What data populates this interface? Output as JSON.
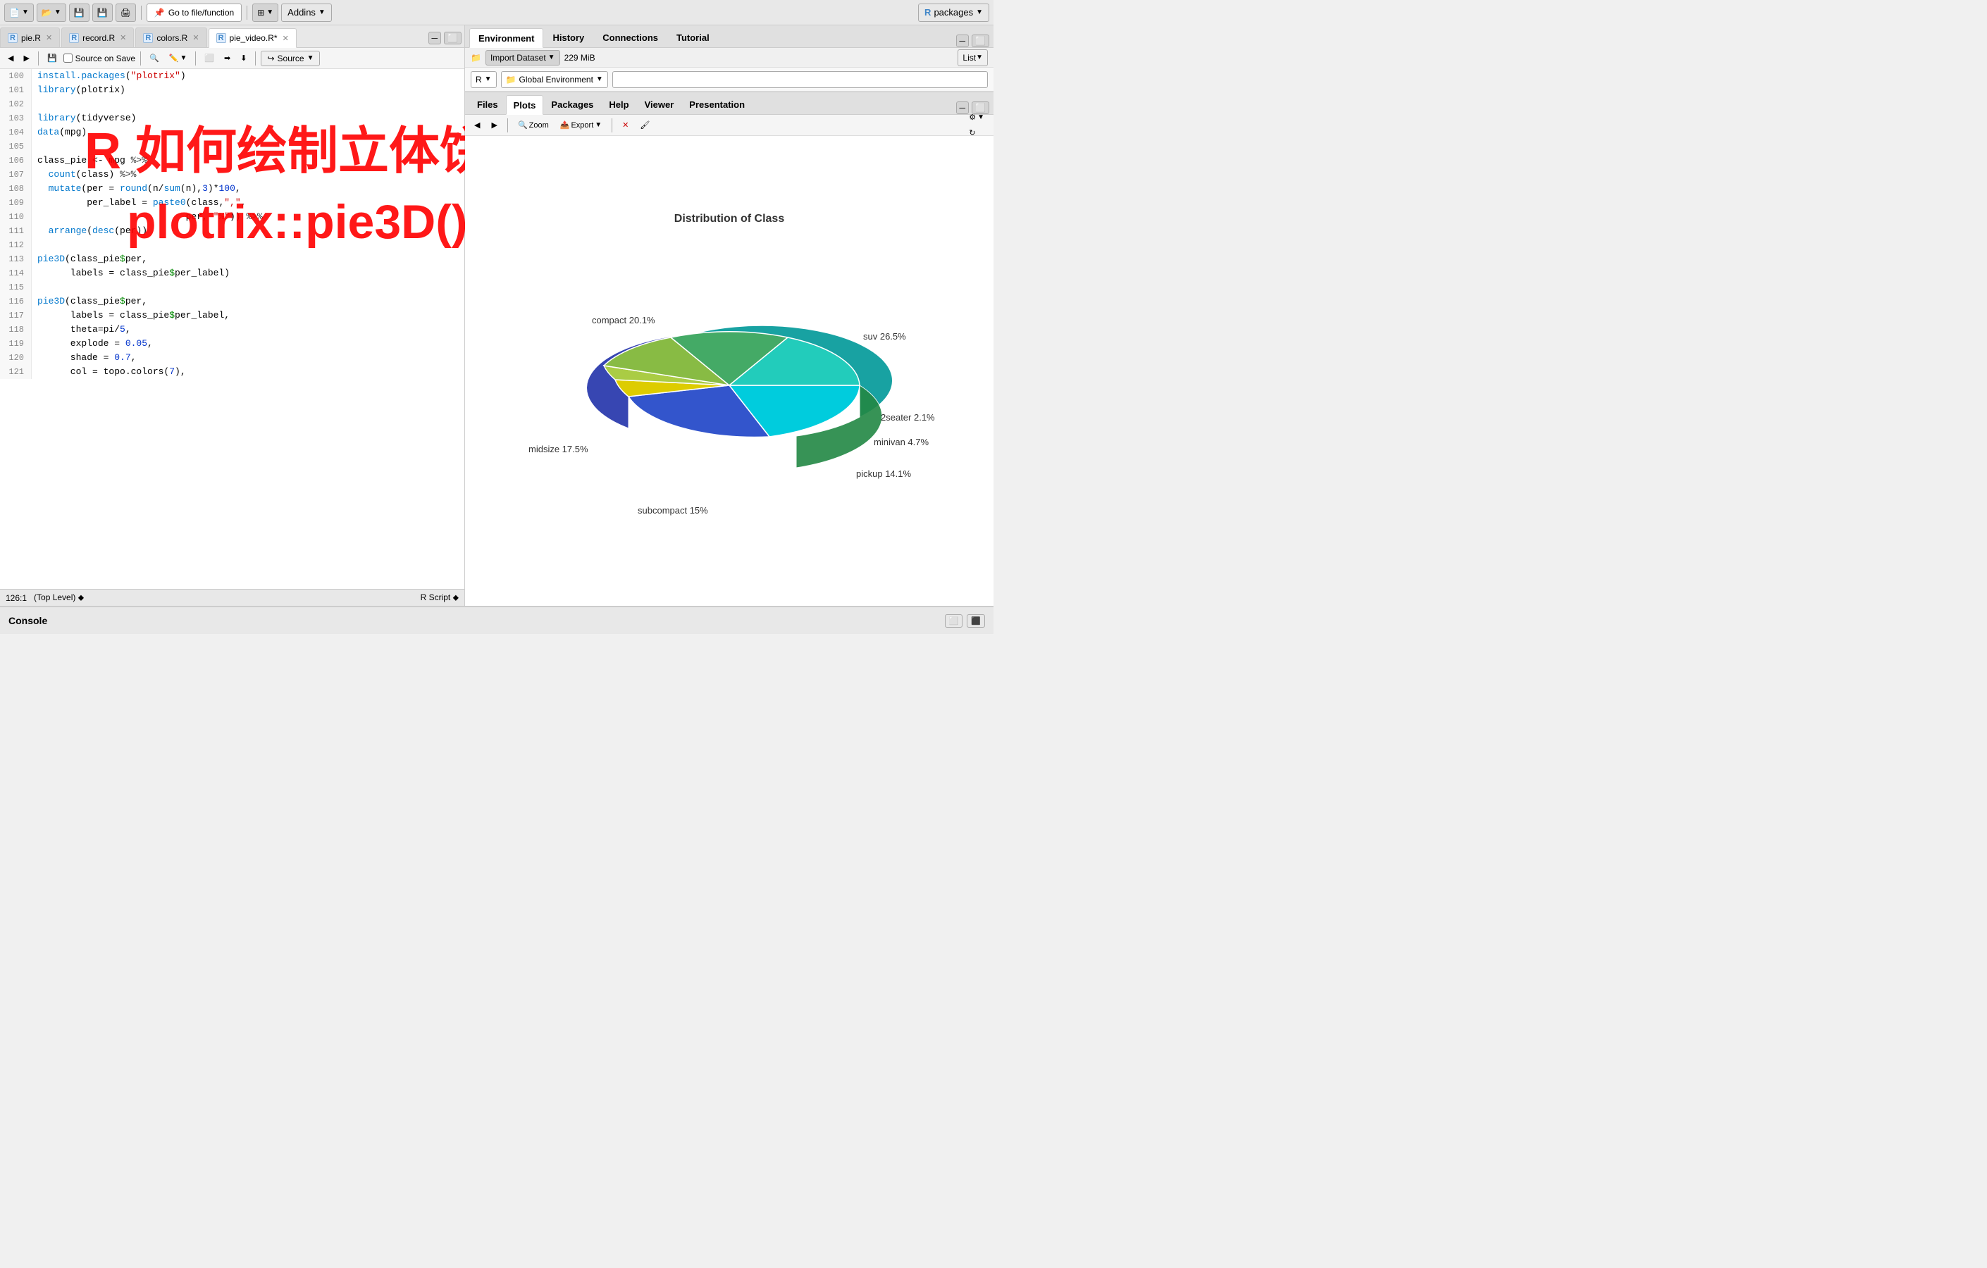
{
  "toolbar": {
    "go_to_file_label": "Go to file/function",
    "addins_label": "Addins",
    "packages_label": "packages",
    "new_file_icon": "📄",
    "open_icon": "📂",
    "save_icon": "💾",
    "print_icon": "🖨"
  },
  "editor": {
    "tabs": [
      {
        "label": "pie.R",
        "active": false,
        "has_icon": true
      },
      {
        "label": "record.R",
        "active": false,
        "has_icon": true
      },
      {
        "label": "colors.R",
        "active": false,
        "has_icon": true
      },
      {
        "label": "pie_video.R*",
        "active": true,
        "has_icon": true
      }
    ],
    "toolbar": {
      "source_on_save_label": "Source on Save",
      "source_label": "Source"
    },
    "status": {
      "position": "126:1",
      "level": "(Top Level)",
      "type": "R Script"
    },
    "lines": [
      {
        "num": 100,
        "code": "install.packages(\"plotrix\")"
      },
      {
        "num": 101,
        "code": "library(plotrix)"
      },
      {
        "num": 102,
        "code": ""
      },
      {
        "num": 103,
        "code": "library(tidyverse)"
      },
      {
        "num": 104,
        "code": "data(mpg)"
      },
      {
        "num": 105,
        "code": ""
      },
      {
        "num": 106,
        "code": "class_pie <- mpg %>%"
      },
      {
        "num": 107,
        "code": "  count(class) %>%"
      },
      {
        "num": 108,
        "code": "  mutate(per = round(n/sum(n),3)*100,"
      },
      {
        "num": 109,
        "code": "         per_label = paste0(class,\",\","
      },
      {
        "num": 110,
        "code": "                           per, \"%\")) %>%"
      },
      {
        "num": 111,
        "code": "  arrange(desc(per))"
      },
      {
        "num": 112,
        "code": ""
      },
      {
        "num": 113,
        "code": "pie3D(class_pie$per,"
      },
      {
        "num": 114,
        "code": "      labels = class_pie$per_label)"
      },
      {
        "num": 115,
        "code": ""
      },
      {
        "num": 116,
        "code": "pie3D(class_pie$per,"
      },
      {
        "num": 117,
        "code": "      labels = class_pie$per_label,"
      },
      {
        "num": 118,
        "code": "      theta=pi/5,"
      },
      {
        "num": 119,
        "code": "      explode = 0.05,"
      },
      {
        "num": 120,
        "code": "      shade = 0.7,"
      },
      {
        "num": 121,
        "code": "      col = topo.colors(7),"
      }
    ]
  },
  "overlay": {
    "title": "R 如何绘制立体饼图?",
    "subtitle": "plotrix::pie3D()"
  },
  "right_panel": {
    "env_tabs": [
      {
        "label": "Environment",
        "active": true
      },
      {
        "label": "History",
        "active": false
      },
      {
        "label": "Connections",
        "active": false
      },
      {
        "label": "Tutorial",
        "active": false
      }
    ],
    "env_toolbar": {
      "import_dataset": "Import Dataset",
      "memory": "229 MiB",
      "list_view": "List"
    },
    "r_dropdown": "R",
    "global_env": "Global Environment",
    "search_placeholder": ""
  },
  "files_panel": {
    "tabs": [
      {
        "label": "Files",
        "active": false
      },
      {
        "label": "Plots",
        "active": true
      },
      {
        "label": "Packages",
        "active": false
      },
      {
        "label": "Help",
        "active": false
      },
      {
        "label": "Viewer",
        "active": false
      },
      {
        "label": "Presentation",
        "active": false
      }
    ],
    "toolbar": {
      "zoom_label": "Zoom",
      "export_label": "Export"
    },
    "chart_title": "Distribution of Class",
    "chart_labels": [
      {
        "label": "compact 20.1%",
        "color": "#00BBDD",
        "percent": 20.1,
        "angle_start": 0
      },
      {
        "label": "suv 26.5%",
        "color": "#3355BB",
        "percent": 26.5,
        "angle_start": 72.36
      },
      {
        "label": "2seater 2.1%",
        "color": "#DDCC00",
        "percent": 2.1,
        "angle_start": 167.76
      },
      {
        "label": "minivan 4.7%",
        "color": "#AACC44",
        "percent": 4.7,
        "angle_start": 175.32
      },
      {
        "label": "pickup 14.1%",
        "color": "#88BB44",
        "percent": 14.1,
        "angle_start": 192.24
      },
      {
        "label": "subcompact 15%",
        "color": "#44AA66",
        "percent": 15.0,
        "angle_start": 243.0
      },
      {
        "label": "midsize 17.5%",
        "color": "#22CCBB",
        "percent": 17.5,
        "angle_start": 297.0
      }
    ]
  },
  "console": {
    "label": "Console"
  }
}
